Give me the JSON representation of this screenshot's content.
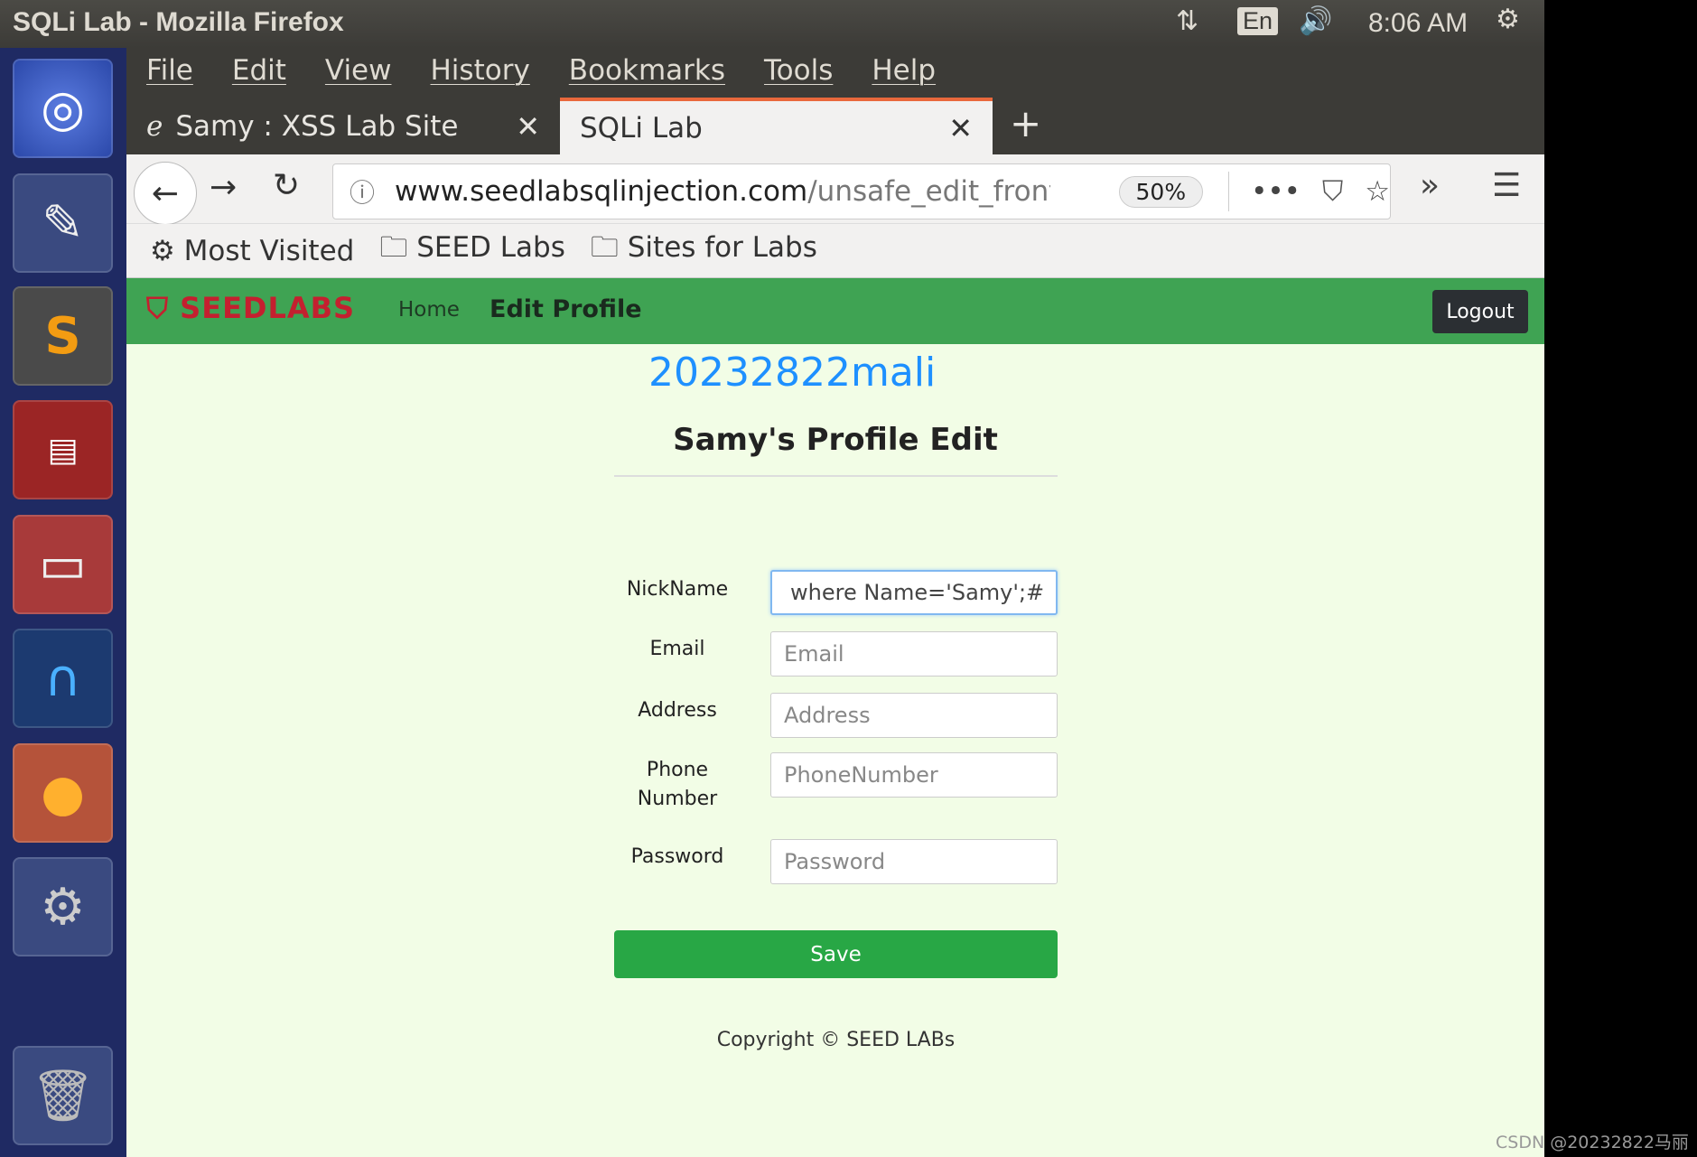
{
  "system": {
    "window_title": "SQLi Lab - Mozilla Firefox",
    "keyboard": "En",
    "time": "8:06 AM"
  },
  "launcher": {
    "icons": [
      "ubuntu-dash-icon",
      "text-editor-icon",
      "sublime-text-icon",
      "terminal-icon",
      "file-manager-icon",
      "wireshark-icon",
      "firefox-icon",
      "system-settings-icon",
      "trash-icon"
    ]
  },
  "menu": [
    "File",
    "Edit",
    "View",
    "History",
    "Bookmarks",
    "Tools",
    "Help"
  ],
  "tabs": [
    {
      "label": "Samy : XSS Lab Site"
    },
    {
      "label": "SQLi Lab",
      "active": true
    }
  ],
  "nav": {
    "url_domain": "www.seedlabsqlinjection.com",
    "url_path": "/unsafe_edit_front",
    "zoom": "50%"
  },
  "bookmarks": [
    "Most Visited",
    "SEED Labs",
    "Sites for Labs"
  ],
  "site": {
    "logo": "SEEDLABS",
    "home": "Home",
    "edit_profile": "Edit Profile",
    "logout": "Logout",
    "accent": "#3fa353"
  },
  "page": {
    "watermark_name": "20232822mali",
    "heading": "Samy's Profile Edit",
    "fields": [
      {
        "label": "NickName",
        "value": "where Name='Samy';#",
        "placeholder": ""
      },
      {
        "label": "Email",
        "value": "",
        "placeholder": "Email"
      },
      {
        "label": "Address",
        "value": "",
        "placeholder": "Address"
      },
      {
        "label": "Phone Number",
        "value": "",
        "placeholder": "PhoneNumber"
      },
      {
        "label": "Password",
        "value": "",
        "placeholder": "Password"
      }
    ],
    "save": "Save",
    "copyright": "Copyright © SEED LABs"
  },
  "csdn_watermark": "CSDN @20232822马丽"
}
